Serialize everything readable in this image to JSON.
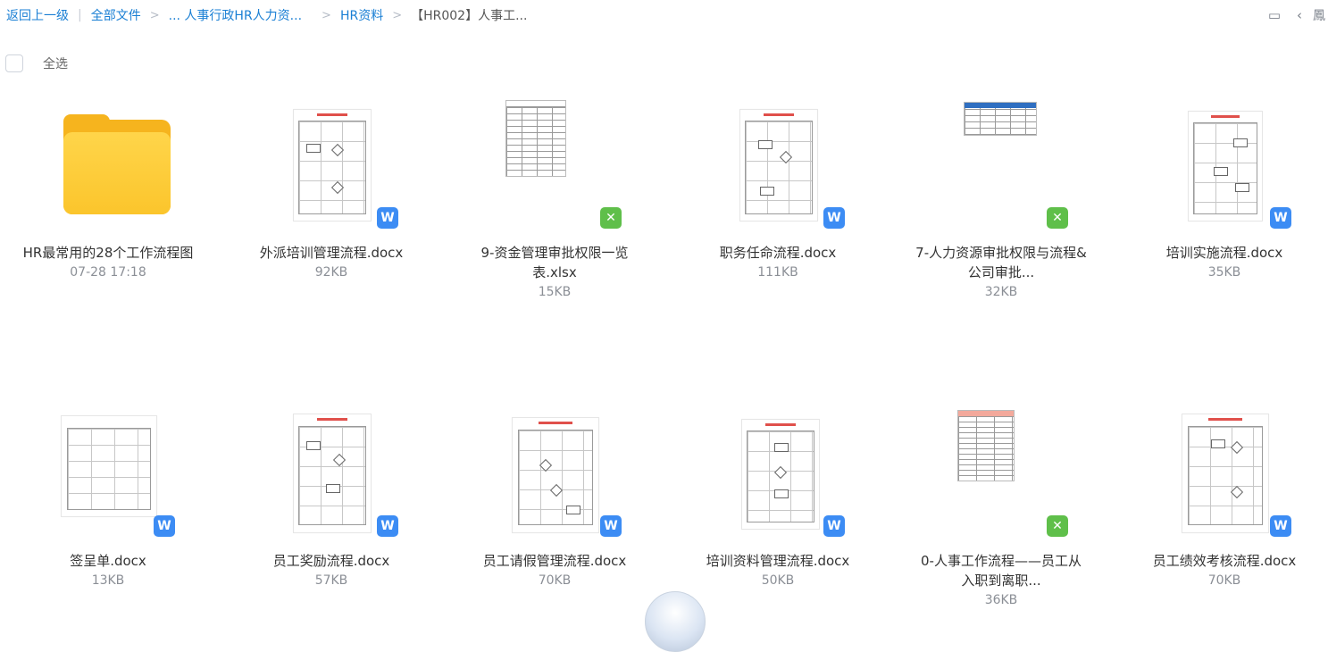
{
  "breadcrumb": {
    "back_label": "返回上一级",
    "items": [
      {
        "label": "全部文件"
      },
      {
        "label": "... 人事行政HR人力资..."
      },
      {
        "label": "HR资料"
      },
      {
        "label": "【HR002】人事工..."
      }
    ],
    "right_text": "鳳"
  },
  "select_all_label": "全选",
  "files": [
    {
      "name": "HR最常用的28个工作流程图",
      "meta": "07-28 17:18",
      "type": "folder"
    },
    {
      "name": "外派培训管理流程.docx",
      "meta": "92KB",
      "type": "word"
    },
    {
      "name": "9-资金管理审批权限一览表.xlsx",
      "meta": "15KB",
      "type": "excel"
    },
    {
      "name": "职务任命流程.docx",
      "meta": "111KB",
      "type": "word"
    },
    {
      "name": "7-人力资源审批权限与流程&公司审批...",
      "meta": "32KB",
      "type": "excel"
    },
    {
      "name": "培训实施流程.docx",
      "meta": "35KB",
      "type": "word"
    },
    {
      "name": "签呈单.docx",
      "meta": "13KB",
      "type": "word"
    },
    {
      "name": "员工奖励流程.docx",
      "meta": "57KB",
      "type": "word"
    },
    {
      "name": "员工请假管理流程.docx",
      "meta": "70KB",
      "type": "word"
    },
    {
      "name": "培训资料管理流程.docx",
      "meta": "50KB",
      "type": "word"
    },
    {
      "name": "0-人事工作流程——员工从入职到离职...",
      "meta": "36KB",
      "type": "excel"
    },
    {
      "name": "员工绩效考核流程.docx",
      "meta": "70KB",
      "type": "word"
    }
  ],
  "badges": {
    "word_glyph": "W",
    "excel_glyph": "✕"
  },
  "colors": {
    "accent": "#1a7fd4",
    "word": "#3c8cf4",
    "excel": "#5fbf4a",
    "folder": "#fbc52c"
  }
}
